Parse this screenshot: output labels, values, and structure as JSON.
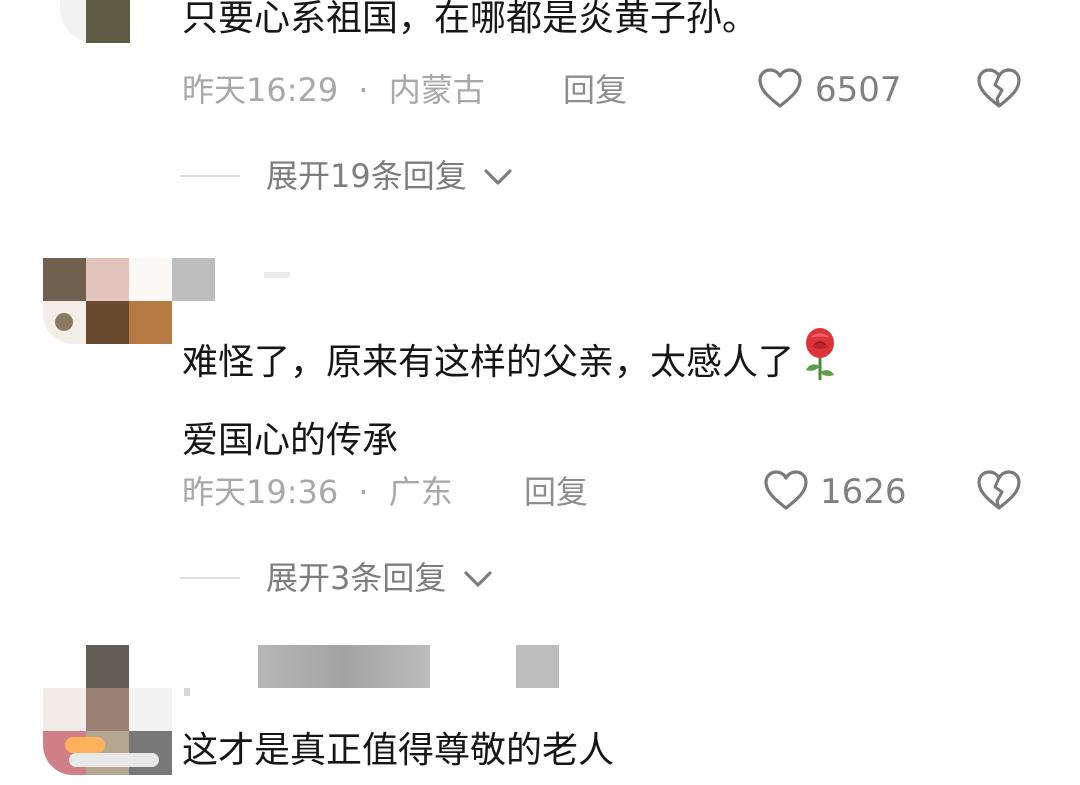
{
  "comments": [
    {
      "text_lines": [
        "只要心系祖国，在哪都是炎黄子孙。"
      ],
      "time": "昨天16:29",
      "location": "内蒙古",
      "reply_label": "回复",
      "likes": "6507",
      "expand_label": "展开19条回复"
    },
    {
      "text_lines": [
        "难怪了，原来有这样的父亲，太感人了",
        "爱国心的传承"
      ],
      "time": "昨天19:36",
      "location": "广东",
      "reply_label": "回复",
      "likes": "1626",
      "expand_label": "展开3条回复",
      "emoji": "rose-icon"
    },
    {
      "text_lines": [
        "这才是真正值得尊敬的老人"
      ]
    }
  ],
  "separator": "·",
  "colors": {
    "text": "#161616",
    "meta": "#a8a8a8",
    "icon": "#7a7a7a"
  }
}
